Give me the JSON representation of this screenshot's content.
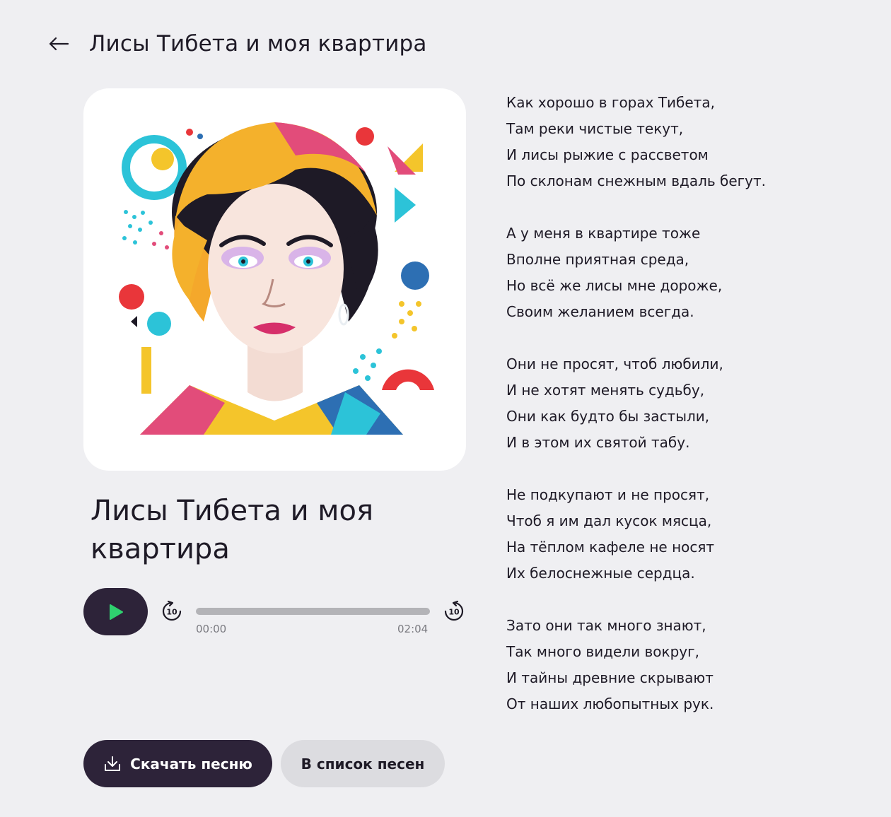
{
  "header": {
    "title": "Лисы Тибета и моя квартира"
  },
  "icons": {
    "back": "arrow-left-icon",
    "play": "play-icon",
    "skip_back": "rewind-10-icon",
    "skip_forward": "forward-10-icon",
    "download": "download-icon"
  },
  "song": {
    "title": "Лисы Тибета и моя квартира"
  },
  "player": {
    "current_time": "00:00",
    "total_time": "02:04",
    "progress": 0,
    "skip_back_label": "10",
    "skip_forward_label": "10"
  },
  "actions": {
    "download_label": "Скачать песню",
    "list_label": "В список песен"
  },
  "colors": {
    "background": "#efeff2",
    "primary_button": "#2d2339",
    "play_icon": "#2fd16f",
    "secondary_button": "#dcdce0"
  },
  "lyrics": {
    "stanzas": [
      {
        "lines": [
          "Как хорошо в горах Тибета,",
          "Там реки чистые текут,",
          "И лисы рыжие с рассветом",
          "По склонам снежным вдаль бегут."
        ]
      },
      {
        "lines": [
          "А у меня в квартире тоже",
          "Вполне приятная среда,",
          "Но всё же лисы мне дороже,",
          "Своим желанием всегда."
        ]
      },
      {
        "lines": [
          "Они не просят, чтоб любили,",
          "И не хотят менять судьбу,",
          "Они как будто бы застыли,",
          "И в этом их святой табу."
        ]
      },
      {
        "lines": [
          "Не подкупают и не просят,",
          "Чтоб я им дал кусок мясца,",
          "На тёплом кафеле не носят",
          "Их белоснежные сердца."
        ]
      },
      {
        "lines": [
          "Зато они так много знают,",
          "Так много видели вокруг,",
          "И тайны древние скрывают",
          "От наших любопытных рук."
        ]
      }
    ]
  }
}
